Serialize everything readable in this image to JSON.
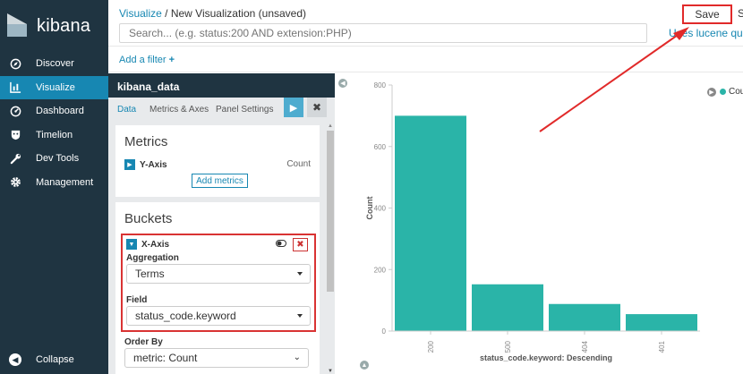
{
  "app": {
    "logo_text": "kibana"
  },
  "sidebar": {
    "items": [
      {
        "label": "Discover",
        "icon": "compass-icon",
        "active": false
      },
      {
        "label": "Visualize",
        "icon": "bar-chart-icon",
        "active": true
      },
      {
        "label": "Dashboard",
        "icon": "dashboard-icon",
        "active": false
      },
      {
        "label": "Timelion",
        "icon": "timelion-icon",
        "active": false
      },
      {
        "label": "Dev Tools",
        "icon": "wrench-icon",
        "active": false
      },
      {
        "label": "Management",
        "icon": "gear-icon",
        "active": false
      }
    ],
    "collapse_label": "Collapse"
  },
  "header": {
    "breadcrumb_link": "Visualize",
    "breadcrumb_sep": " / ",
    "breadcrumb_current": "New Visualization (unsaved)",
    "save_label": "Save",
    "next_label": "S",
    "search_placeholder": "Search... (e.g. status:200 AND extension:PHP)",
    "lucene_label": "Uses lucene query",
    "add_filter_label": "Add a filter",
    "add_filter_plus": "+"
  },
  "editor": {
    "index_name": "kibana_data",
    "tabs": [
      "Data",
      "Metrics & Axes",
      "Panel Settings"
    ],
    "active_tab": 0,
    "metrics_title": "Metrics",
    "y_axis_label": "Y-Axis",
    "y_axis_agg": "Count",
    "add_metrics_label": "Add metrics",
    "buckets_title": "Buckets",
    "x_axis_label": "X-Axis",
    "aggregation_label": "Aggregation",
    "aggregation_value": "Terms",
    "field_label": "Field",
    "field_value": "status_code.keyword",
    "order_by_label": "Order By",
    "order_by_value": "metric: Count"
  },
  "legend": {
    "label": "Count",
    "color": "#2ab4a8"
  },
  "colors": {
    "accent": "#1787b2",
    "sidebar": "#1f3441",
    "bar": "#2ab4a8",
    "annotation": "#e12a2a"
  },
  "chart_data": {
    "type": "bar",
    "categories": [
      "200",
      "500",
      "404",
      "401"
    ],
    "values": [
      700,
      152,
      88,
      55
    ],
    "xlabel": "status_code.keyword: Descending",
    "ylabel": "Count",
    "ylim": [
      0,
      800
    ],
    "yticks": [
      0,
      200,
      400,
      600,
      800
    ],
    "grid": false,
    "legend_position": "top-right"
  }
}
